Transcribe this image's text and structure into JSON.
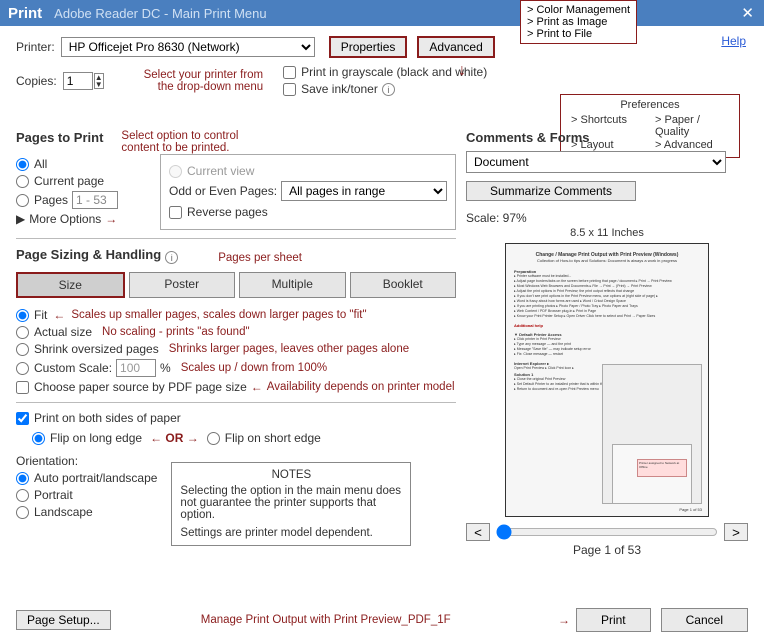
{
  "title": "Print",
  "subtitle": "Adobe Reader DC - Main Print Menu",
  "adv_callout": [
    "> Color Management",
    "> Print as Image",
    "> Print to File"
  ],
  "help": "Help",
  "printer_label": "Printer:",
  "printer_value": "HP Officejet Pro 8630 (Network)",
  "properties": "Properties",
  "advanced": "Advanced",
  "copies_label": "Copies:",
  "copies_value": "1",
  "annot_printer1": "Select your printer from",
  "annot_printer2": "the drop-down menu",
  "grayscale": "Print in grayscale (black and white)",
  "saveink": "Save ink/toner",
  "prefs": {
    "title": "Preferences",
    "items": [
      "> Shortcuts",
      "> Paper / Quality",
      "> Layout",
      "> Advanced"
    ]
  },
  "pages_hdr": "Pages to Print",
  "annot_pages1": "Select option to control",
  "annot_pages2": "content to be printed.",
  "opt_all": "All",
  "opt_current": "Current page",
  "opt_pages": "Pages",
  "pages_range": "1 - 53",
  "more_options": "More Options",
  "current_view": "Current view",
  "odd_even_lbl": "Odd or Even Pages:",
  "odd_even_val": "All pages in range",
  "reverse": "Reverse pages",
  "sizing_hdr": "Page Sizing & Handling",
  "pages_per_sheet": "Pages per sheet",
  "tab_size": "Size",
  "tab_poster": "Poster",
  "tab_multiple": "Multiple",
  "tab_booklet": "Booklet",
  "fit": "Fit",
  "fit_annot": "Scales up smaller pages, scales down larger pages to \"fit\"",
  "actual": "Actual size",
  "actual_annot": "No scaling - prints \"as found\"",
  "shrink": "Shrink oversized pages",
  "shrink_annot": "Shrinks larger pages, leaves other pages alone",
  "custom_scale": "Custom Scale:",
  "custom_val": "100",
  "custom_pct": "%",
  "custom_annot": "Scales up / down from 100%",
  "paper_source": "Choose paper source by PDF page size",
  "paper_source_annot": "Availability depends on printer model",
  "both_sides": "Print on both sides of paper",
  "flip_long": "Flip on long edge",
  "flip_short": "Flip on short edge",
  "or": "OR",
  "orientation": "Orientation:",
  "auto": "Auto portrait/landscape",
  "portrait": "Portrait",
  "landscape": "Landscape",
  "notes_hdr": "NOTES",
  "notes1": "Selecting the option in the main menu does not guarantee the printer supports that option.",
  "notes2": "Settings are printer model dependent.",
  "page_setup": "Page Setup...",
  "footer_note": "Manage Print Output with Print Preview_PDF_1F",
  "comments_hdr": "Comments & Forms",
  "comments_val": "Document",
  "summarize": "Summarize Comments",
  "scale": "Scale:  97%",
  "paper_dim": "8.5 x 11 Inches",
  "page_of": "Page 1 of 53",
  "print_btn": "Print",
  "cancel_btn": "Cancel",
  "nav_prev": "<",
  "nav_next": ">"
}
